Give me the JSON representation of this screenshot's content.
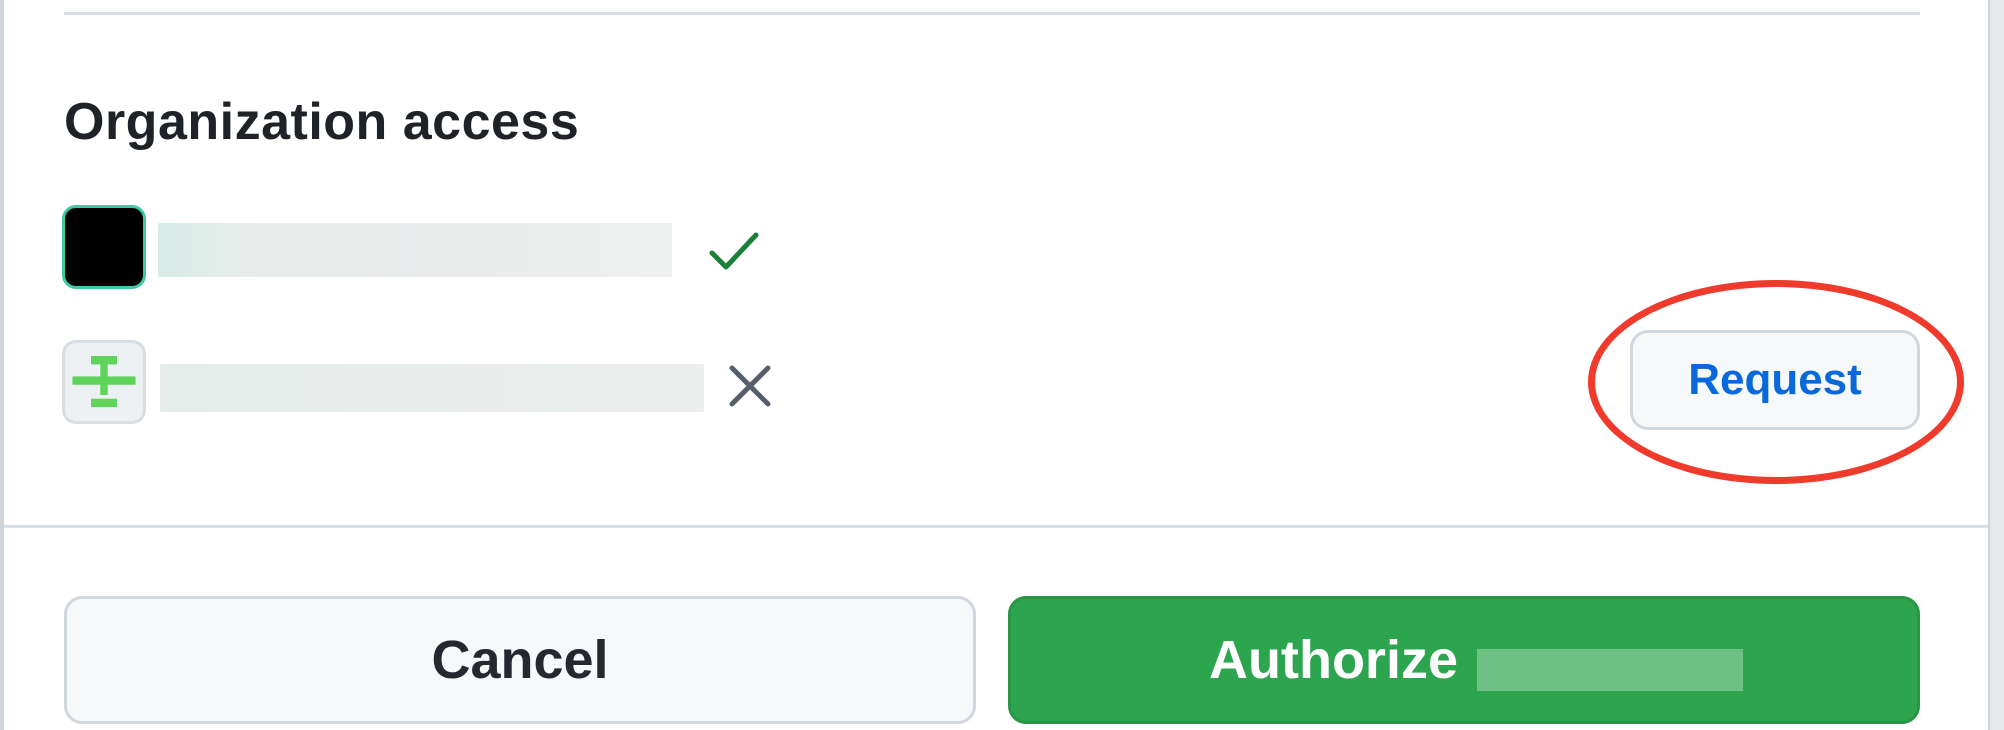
{
  "section": {
    "title": "Organization access"
  },
  "organizations": [
    {
      "status": "granted",
      "status_icon": "check-icon"
    },
    {
      "status": "denied",
      "status_icon": "x-icon"
    }
  ],
  "request_button": {
    "label": "Request"
  },
  "footer": {
    "cancel_label": "Cancel",
    "authorize_label": "Authorize"
  },
  "colors": {
    "accent_blue": "#0969da",
    "success_green": "#1a7f37",
    "authorize_green": "#2da44e",
    "highlight_red": "#f03a2b",
    "muted_gray": "#57606a"
  }
}
